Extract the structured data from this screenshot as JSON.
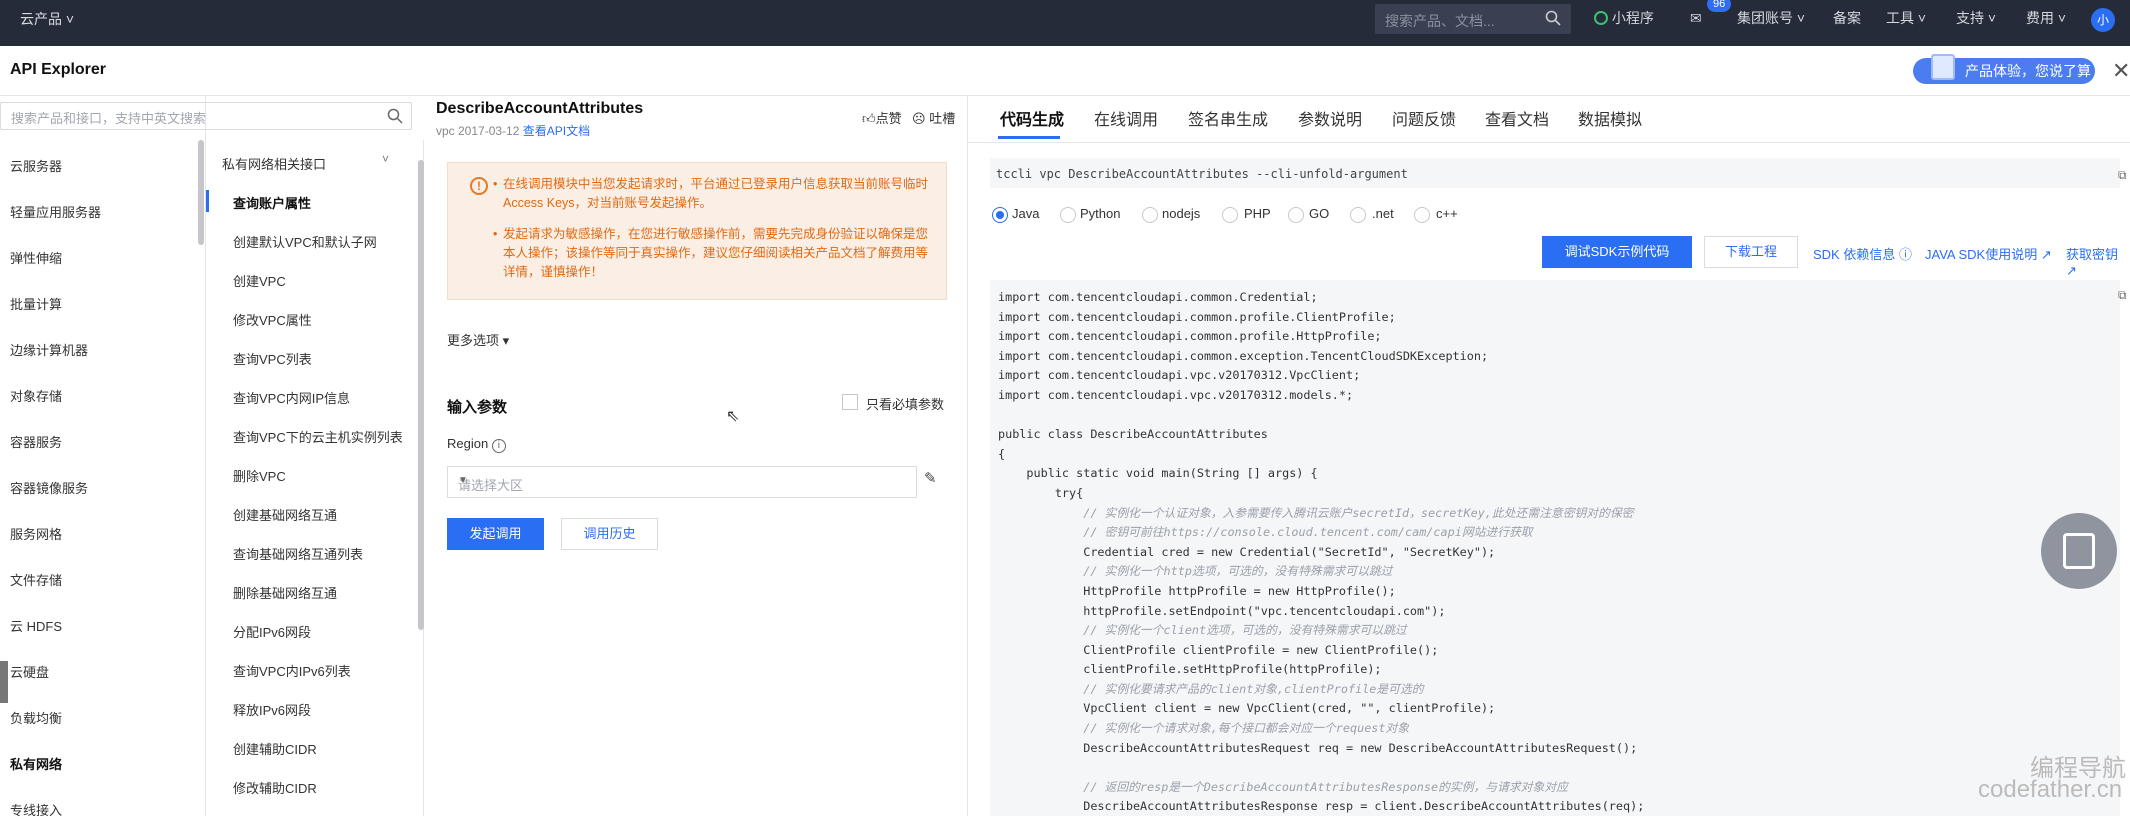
{
  "topbar": {
    "brand": "云产品",
    "search_placeholder": "搜索产品、文档...",
    "mini_program": "小程序",
    "badge": "96",
    "group_account": "集团账号",
    "beian": "备案",
    "tools": "工具",
    "support": "支持",
    "fees": "费用",
    "avatar": "小"
  },
  "header": {
    "title": "API Explorer",
    "promo": "产品体验，您说了算"
  },
  "left": {
    "search_placeholder": "搜索产品和接口，支持中英文搜索",
    "products": [
      "云服务器",
      "轻量应用服务器",
      "弹性伸缩",
      "批量计算",
      "边缘计算机器",
      "对象存储",
      "容器服务",
      "容器镜像服务",
      "服务网格",
      "文件存储",
      "云 HDFS",
      "云硬盘",
      "负载均衡",
      "私有网络",
      "专线接入"
    ]
  },
  "apis": {
    "group": "私有网络相关接口",
    "items": [
      "查询账户属性",
      "创建默认VPC和默认子网",
      "创建VPC",
      "修改VPC属性",
      "查询VPC列表",
      "查询VPC内网IP信息",
      "查询VPC下的云主机实例列表",
      "删除VPC",
      "创建基础网络互通",
      "查询基础网络互通列表",
      "删除基础网络互通",
      "分配IPv6网段",
      "查询VPC内IPv6列表",
      "释放IPv6网段",
      "创建辅助CIDR",
      "修改辅助CIDR"
    ]
  },
  "middle": {
    "api_name": "DescribeAccountAttributes",
    "api_version": "vpc 2017-03-12",
    "doc_link": "查看API文档",
    "like": "点赞",
    "tucao": "吐槽",
    "warn1": "在线调用模块中当您发起请求时，平台通过已登录用户信息获取当前账号临时Access Keys，对当前账号发起操作。",
    "warn2": "发起请求为敏感操作，在您进行敏感操作前，需要先完成身份验证以确保是您本人操作；该操作等同于真实操作，建议您仔细阅读相关产品文档了解费用等详情，谨慎操作！",
    "more_options": "更多选项",
    "input_params": "输入参数",
    "only_required": "只看必填参数",
    "region_label": "Region",
    "region_placeholder": "请选择大区",
    "submit": "发起调用",
    "history": "调用历史"
  },
  "right": {
    "tabs": [
      "代码生成",
      "在线调用",
      "签名串生成",
      "参数说明",
      "问题反馈",
      "查看文档",
      "数据模拟"
    ],
    "cli": "tccli vpc DescribeAccountAttributes --cli-unfold-argument",
    "langs": [
      "Java",
      "Python",
      "nodejs",
      "PHP",
      "GO",
      ".net",
      "c++"
    ],
    "selected_lang": "Java",
    "debug_sdk": "调试SDK示例代码",
    "download": "下载工程",
    "sdk_deps": "SDK 依赖信息",
    "java_sdk": "JAVA SDK使用说明",
    "get_key": "获取密钥",
    "code": [
      "import com.tencentcloudapi.common.Credential;",
      "import com.tencentcloudapi.common.profile.ClientProfile;",
      "import com.tencentcloudapi.common.profile.HttpProfile;",
      "import com.tencentcloudapi.common.exception.TencentCloudSDKException;",
      "import com.tencentcloudapi.vpc.v20170312.VpcClient;",
      "import com.tencentcloudapi.vpc.v20170312.models.*;",
      "",
      "public class DescribeAccountAttributes",
      "{",
      "    public static void main(String [] args) {",
      "        try{",
      "            // 实例化一个认证对象，入参需要传入腾讯云账户secretId，secretKey,此处还需注意密钥对的保密",
      "            // 密钥可前往https://console.cloud.tencent.com/cam/capi网站进行获取",
      "            Credential cred = new Credential(\"SecretId\", \"SecretKey\");",
      "            // 实例化一个http选项，可选的，没有特殊需求可以跳过",
      "            HttpProfile httpProfile = new HttpProfile();",
      "            httpProfile.setEndpoint(\"vpc.tencentcloudapi.com\");",
      "            // 实例化一个client选项，可选的，没有特殊需求可以跳过",
      "            ClientProfile clientProfile = new ClientProfile();",
      "            clientProfile.setHttpProfile(httpProfile);",
      "            // 实例化要请求产品的client对象,clientProfile是可选的",
      "            VpcClient client = new VpcClient(cred, \"\", clientProfile);",
      "            // 实例化一个请求对象,每个接口都会对应一个request对象",
      "            DescribeAccountAttributesRequest req = new DescribeAccountAttributesRequest();",
      "",
      "            // 返回的resp是一个DescribeAccountAttributesResponse的实例，与请求对象对应",
      "            DescribeAccountAttributesResponse resp = client.DescribeAccountAttributes(req);"
    ]
  },
  "watermark": {
    "cn": "编程导航",
    "en": "codefather.cn"
  }
}
